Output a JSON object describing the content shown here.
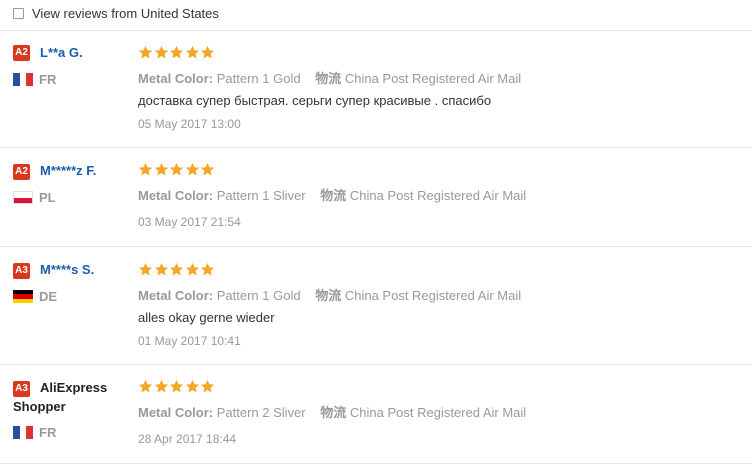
{
  "filter": {
    "label": "View reviews from United States",
    "checked": false
  },
  "metal_color_label": "Metal Color:",
  "shipping_label": "物流",
  "reviews": [
    {
      "badge": "A2",
      "name": "L**a G.",
      "country_code": "FR",
      "flag": "france-flag-icon",
      "stars": 5,
      "metal_color": "Pattern 1 Gold",
      "shipping": "China Post Registered Air Mail",
      "comment": "доставка супер быстрая. серьги супер красивые . спасибо",
      "date": "05 May 2017 13:00"
    },
    {
      "badge": "A2",
      "name": "M*****z F.",
      "country_code": "PL",
      "flag": "poland-flag-icon",
      "stars": 5,
      "metal_color": "Pattern 1 Sliver",
      "shipping": "China Post Registered Air Mail",
      "comment": "",
      "date": "03 May 2017 21:54"
    },
    {
      "badge": "A3",
      "name": "M****s S.",
      "country_code": "DE",
      "flag": "germany-flag-icon",
      "stars": 5,
      "metal_color": "Pattern 1 Gold",
      "shipping": "China Post Registered Air Mail",
      "comment": "alles okay gerne wieder",
      "date": "01 May 2017 10:41"
    },
    {
      "badge": "A3",
      "name": "AliExpress Shopper",
      "country_code": "FR",
      "flag": "france-flag-icon",
      "stars": 5,
      "metal_color": "Pattern 2 Sliver",
      "shipping": "China Post Registered Air Mail",
      "comment": "",
      "date": "28 Apr 2017 18:44"
    }
  ],
  "colors": {
    "badge": "#d9381e",
    "name": "#1a5eb0",
    "star": "#f5a623",
    "muted": "#999999",
    "divider": "#e6e6e6"
  }
}
